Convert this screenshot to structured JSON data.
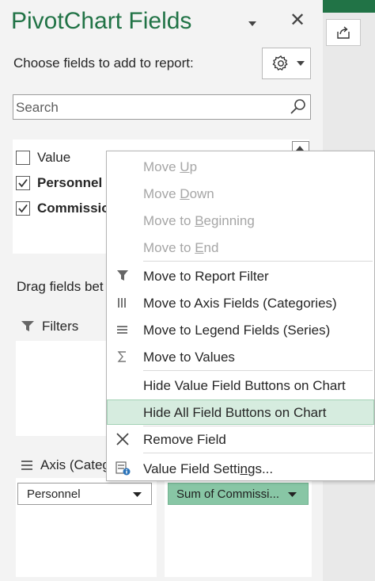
{
  "panel": {
    "title": "PivotChart Fields",
    "choose_label": "Choose fields to add to report:",
    "search": {
      "placeholder": "Search"
    },
    "fields": [
      {
        "label": "Value",
        "checked": false,
        "bold": false
      },
      {
        "label": "Personnel",
        "checked": true,
        "bold": true
      },
      {
        "label": "Commissio",
        "checked": true,
        "bold": true
      }
    ],
    "drag_label": "Drag fields bet",
    "areas": {
      "filters_label": "Filters",
      "axis_label": "Axis (Categ",
      "axis_pill": "Personnel",
      "values_pill": "Sum of Commissi..."
    }
  },
  "context_menu": {
    "items": [
      {
        "pre": "Move ",
        "key": "U",
        "post": "p",
        "disabled": true,
        "icon": ""
      },
      {
        "pre": "Move ",
        "key": "D",
        "post": "own",
        "disabled": true,
        "icon": ""
      },
      {
        "pre": "Move to ",
        "key": "B",
        "post": "eginning",
        "disabled": true,
        "icon": ""
      },
      {
        "pre": "Move to ",
        "key": "E",
        "post": "nd",
        "disabled": true,
        "icon": ""
      },
      {
        "pre": "Move to Report Filter",
        "key": "",
        "post": "",
        "disabled": false,
        "icon": "filter-icon"
      },
      {
        "pre": "Move to Axis Fields (Categories)",
        "key": "",
        "post": "",
        "disabled": false,
        "icon": "axis-fields-icon"
      },
      {
        "pre": "Move to Legend Fields (Series)",
        "key": "",
        "post": "",
        "disabled": false,
        "icon": "legend-fields-icon"
      },
      {
        "pre": "Move to Values",
        "key": "",
        "post": "",
        "disabled": false,
        "icon": "sigma-icon"
      },
      {
        "pre": "Hide Value Field Buttons on Chart",
        "key": "",
        "post": "",
        "disabled": false,
        "icon": ""
      },
      {
        "pre": "Hide All Field Buttons on Chart",
        "key": "",
        "post": "",
        "disabled": false,
        "icon": "",
        "highlighted": true
      },
      {
        "pre": "Remove Field",
        "key": "",
        "post": "",
        "disabled": false,
        "icon": "remove-icon"
      },
      {
        "pre": "Value Field Setti",
        "key": "n",
        "post": "gs...",
        "disabled": false,
        "icon": "field-settings-icon"
      }
    ]
  },
  "colors": {
    "accent": "#217346",
    "highlight": "#d6ecdf",
    "pill_green": "#88c6a5"
  }
}
